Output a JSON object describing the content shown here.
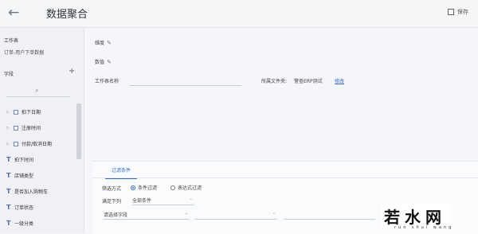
{
  "header": {
    "title": "数据聚合",
    "save_label": "保存",
    "back_icon": "←"
  },
  "left": {
    "worksheet_heading": "工作表",
    "worksheet_name": "订单-用户下单数据",
    "fields_heading": "字段",
    "add_icon": "+",
    "search_icon": "⌕",
    "fields": [
      {
        "label": "拍下日期",
        "type": "date",
        "expand": "▷"
      },
      {
        "label": "注册时间",
        "type": "date",
        "expand": "▷"
      },
      {
        "label": "付款/取消日期",
        "type": "date",
        "expand": "▷"
      },
      {
        "label": "拍下时间",
        "type": "text",
        "icon": "T"
      },
      {
        "label": "店铺类型",
        "type": "text",
        "icon": "T"
      },
      {
        "label": "是否加入购物车",
        "type": "text",
        "icon": "T"
      },
      {
        "label": "订单状态",
        "type": "text",
        "icon": "T"
      },
      {
        "label": "一级分类",
        "type": "text",
        "icon": "T"
      }
    ]
  },
  "main": {
    "dimension_label": "维度",
    "measure_label": "数值",
    "pencil_icon": "✎",
    "worksheet_name_label": "工作表名称",
    "folder_label": "所属文件夹:",
    "folder_value": "警查ERP测试",
    "modify_link": "修改"
  },
  "filter": {
    "tab_label": "过滤条件",
    "mode_label": "筛选方式",
    "radio_condition": "条件过滤",
    "radio_formula": "表达式过滤",
    "satisfy_label": "满足下列",
    "satisfy_value": "全部条件",
    "condition_placeholder": "请选择字段",
    "caret": "⌄"
  },
  "watermark": {
    "main": "若水网",
    "sub": "ruo  shui  wang"
  }
}
